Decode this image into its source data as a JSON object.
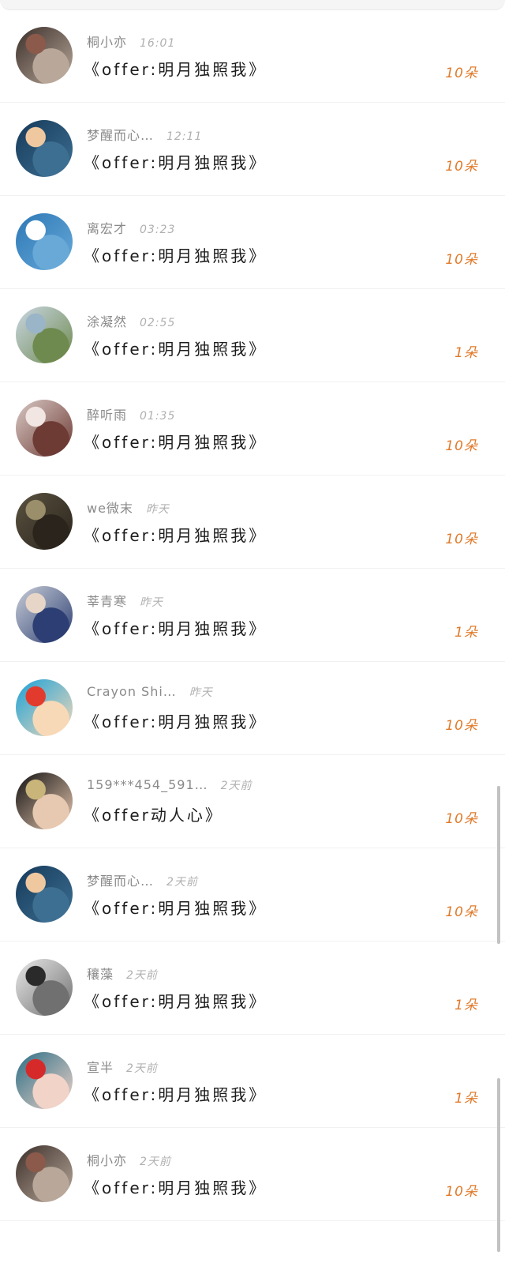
{
  "items": [
    {
      "name": "桐小亦",
      "time": "16:01",
      "title": "《offer:明月独照我》",
      "count": "10朵",
      "avatar": {
        "c1": "#3b2f2a",
        "c2": "#b9a89a",
        "accent": "#8b5a4a"
      }
    },
    {
      "name": "梦醒而心…",
      "time": "12:11",
      "title": "《offer:明月独照我》",
      "count": "10朵",
      "avatar": {
        "c1": "#163a5a",
        "c2": "#3d6f92",
        "accent": "#f0c8a0"
      }
    },
    {
      "name": "离宏才",
      "time": "03:23",
      "title": "《offer:明月独照我》",
      "count": "10朵",
      "avatar": {
        "c1": "#2c78b6",
        "c2": "#68a9d8",
        "accent": "#ffffff"
      }
    },
    {
      "name": "涂凝然",
      "time": "02:55",
      "title": "《offer:明月独照我》",
      "count": "1朵",
      "avatar": {
        "c1": "#c9d6e2",
        "c2": "#6f8a4f",
        "accent": "#9ab4c8"
      }
    },
    {
      "name": "醉听雨",
      "time": "01:35",
      "title": "《offer:明月独照我》",
      "count": "10朵",
      "avatar": {
        "c1": "#d8c8c4",
        "c2": "#6d3a34",
        "accent": "#f2e6e2"
      }
    },
    {
      "name": "we微末",
      "time": "昨天",
      "title": "《offer:明月独照我》",
      "count": "10朵",
      "avatar": {
        "c1": "#5a5240",
        "c2": "#2a241c",
        "accent": "#9b8e6a"
      }
    },
    {
      "name": "莘青寒",
      "time": "昨天",
      "title": "《offer:明月独照我》",
      "count": "1朵",
      "avatar": {
        "c1": "#c8cdd6",
        "c2": "#2c3e73",
        "accent": "#e7d6c8"
      }
    },
    {
      "name": "Crayon Shi…",
      "time": "昨天",
      "title": "《offer:明月独照我》",
      "count": "10朵",
      "avatar": {
        "c1": "#1ba2d8",
        "c2": "#f7d9b8",
        "accent": "#e23b2e"
      }
    },
    {
      "name": "159***454_591…",
      "time": "2天前",
      "title": "《offer动人心》",
      "count": "10朵",
      "avatar": {
        "c1": "#111111",
        "c2": "#e7c8b0",
        "accent": "#c9b47a"
      }
    },
    {
      "name": "梦醒而心…",
      "time": "2天前",
      "title": "《offer:明月独照我》",
      "count": "10朵",
      "avatar": {
        "c1": "#163a5a",
        "c2": "#3d6f92",
        "accent": "#f0c8a0"
      }
    },
    {
      "name": "穰藻",
      "time": "2天前",
      "title": "《offer:明月独照我》",
      "count": "1朵",
      "avatar": {
        "c1": "#e8e8e8",
        "c2": "#707070",
        "accent": "#2a2a2a"
      }
    },
    {
      "name": "宣半",
      "time": "2天前",
      "title": "《offer:明月独照我》",
      "count": "1朵",
      "avatar": {
        "c1": "#2a6e86",
        "c2": "#f1d3c8",
        "accent": "#d62a2a"
      }
    },
    {
      "name": "桐小亦",
      "time": "2天前",
      "title": "《offer:明月独照我》",
      "count": "10朵",
      "avatar": {
        "c1": "#3b2f2a",
        "c2": "#b9a89a",
        "accent": "#8b5a4a"
      }
    }
  ],
  "colors": {
    "count": "#e07a2a",
    "name": "#8a8a8a",
    "time": "#b0b0b0",
    "title": "#1c1c1c"
  }
}
